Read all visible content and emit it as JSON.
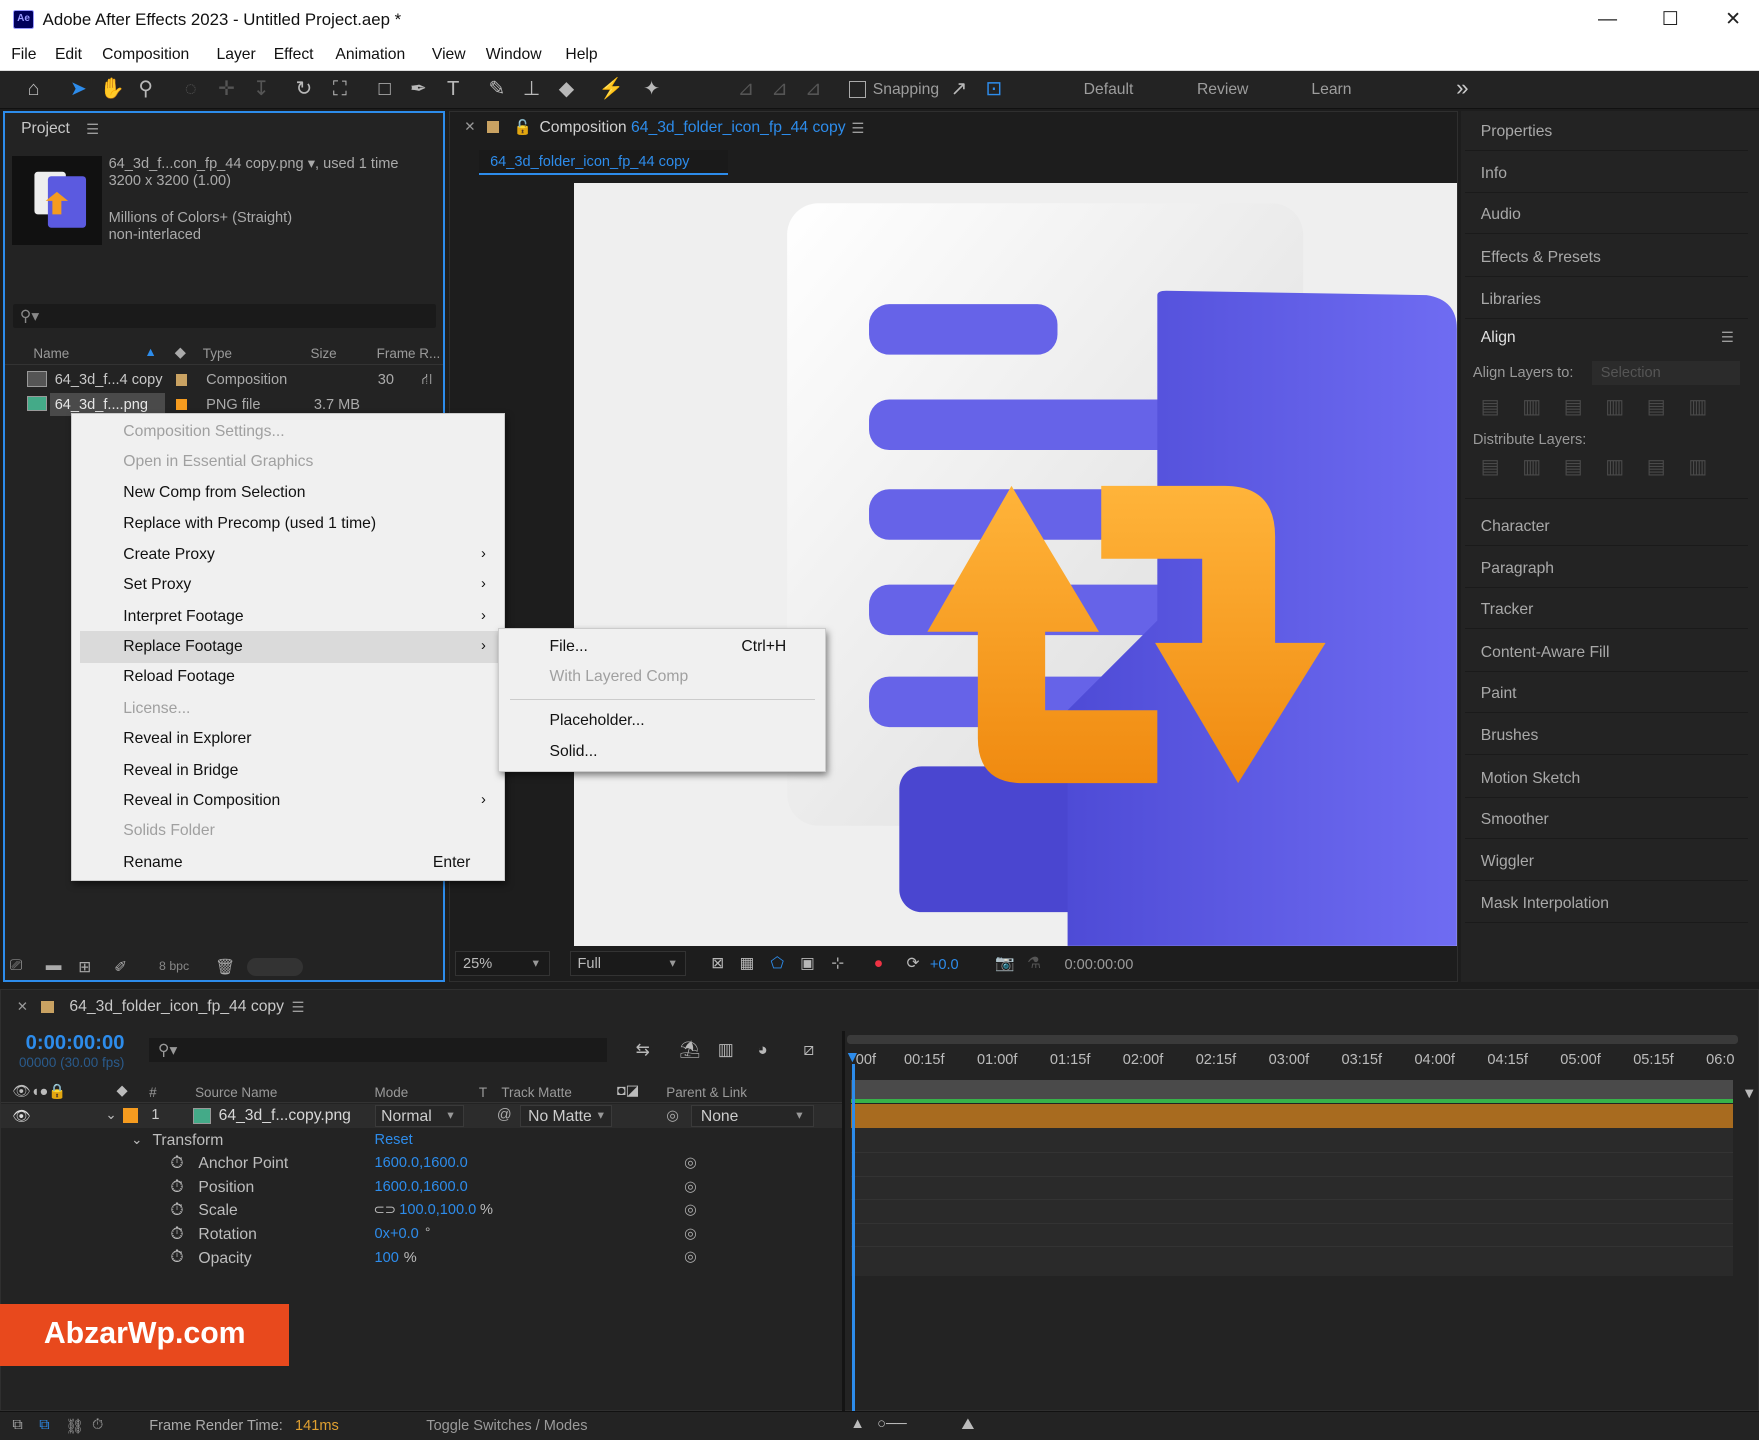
{
  "window": {
    "title": "Adobe After Effects 2023 - Untitled Project.aep *",
    "app_icon": "Ae",
    "minimize": "—",
    "maximize": "☐",
    "close": "✕"
  },
  "menu": [
    "File",
    "Edit",
    "Composition",
    "Layer",
    "Effect",
    "Animation",
    "View",
    "Window",
    "Help"
  ],
  "toolbar": {
    "snapping_label": "Snapping",
    "workspaces": [
      "Default",
      "Review",
      "Learn"
    ],
    "more": "»"
  },
  "project": {
    "title": "Project",
    "footage_name": "64_3d_f...con_fp_44 copy.png",
    "used": ", used 1 time",
    "dims": "3200 x 3200 (1.00)",
    "colors": "Millions of Colors+ (Straight)",
    "interlace": "non-interlaced",
    "columns": [
      "Name",
      "Type",
      "Size",
      "Frame R..."
    ],
    "rows": [
      {
        "name": "64_3d_f...4 copy",
        "type": "Composition",
        "size": "",
        "rate": "30"
      },
      {
        "name": "64_3d_f....png",
        "type": "PNG file",
        "size": "3.7 MB",
        "rate": ""
      }
    ],
    "bpc": "8 bpc"
  },
  "context_menu": {
    "items": [
      {
        "label": "Composition Settings...",
        "disabled": true
      },
      {
        "label": "Open in Essential Graphics",
        "disabled": true
      },
      {
        "label": "New Comp from Selection",
        "disabled": false
      },
      {
        "label": "Replace with Precomp (used 1 time)",
        "disabled": false
      },
      {
        "label": "Create Proxy",
        "disabled": false,
        "sub": true
      },
      {
        "label": "Set Proxy",
        "disabled": false,
        "sub": true
      },
      {
        "label": "Interpret Footage",
        "disabled": false,
        "sub": true
      },
      {
        "label": "Replace Footage",
        "disabled": false,
        "sub": true,
        "hover": true
      },
      {
        "label": "Reload Footage",
        "disabled": false
      },
      {
        "label": "License...",
        "disabled": true
      },
      {
        "label": "Reveal in Explorer",
        "disabled": false
      },
      {
        "label": "Reveal in Bridge",
        "disabled": false
      },
      {
        "label": "Reveal in Composition",
        "disabled": false,
        "sub": true
      },
      {
        "label": "Solids Folder",
        "disabled": true
      },
      {
        "label": "Rename",
        "disabled": false,
        "shortcut": "Enter"
      }
    ]
  },
  "submenu": {
    "file": "File...",
    "file_shortcut": "Ctrl+H",
    "layered": "With Layered Comp",
    "placeholder": "Placeholder...",
    "solid": "Solid..."
  },
  "composition": {
    "title_prefix": "Composition",
    "comp_name": "64_3d_folder_icon_fp_44 copy",
    "tab": "64_3d_folder_icon_fp_44 copy",
    "zoom": "25%",
    "resolution": "Full",
    "exposure": "+0.0",
    "timecode": "0:00:00:00"
  },
  "right_panels": {
    "top": [
      "Properties",
      "Info",
      "Audio",
      "Effects & Presets",
      "Libraries"
    ],
    "align_title": "Align",
    "align_layers_to": "Align Layers to:",
    "align_selection": "Selection",
    "distribute": "Distribute Layers:",
    "bottom": [
      "Character",
      "Paragraph",
      "Tracker",
      "Content-Aware Fill",
      "Paint",
      "Brushes",
      "Motion Sketch",
      "Smoother",
      "Wiggler",
      "Mask Interpolation"
    ]
  },
  "timeline": {
    "tab_name": "64_3d_folder_icon_fp_44 copy",
    "timecode": "0:00:00:00",
    "frames": "00000 (30.00 fps)",
    "columns": {
      "source": "Source Name",
      "mode": "Mode",
      "t": "T",
      "matte": "Track Matte",
      "parent": "Parent & Link",
      "num": "#"
    },
    "layer": {
      "num": "1",
      "name": "64_3d_f...copy.png",
      "mode": "Normal",
      "matte": "No Matte",
      "parent": "None"
    },
    "transform": "Transform",
    "reset": "Reset",
    "props": [
      {
        "name": "Anchor Point",
        "value": "1600.0,1600.0"
      },
      {
        "name": "Position",
        "value": "1600.0,1600.0"
      },
      {
        "name": "Scale",
        "value": "100.0,100.0",
        "unit": "%"
      },
      {
        "name": "Rotation",
        "value": "0x+0.0",
        "unit": "°"
      },
      {
        "name": "Opacity",
        "value": "100",
        "unit": "%"
      }
    ],
    "ticks": [
      "00f",
      "00:15f",
      "01:00f",
      "01:15f",
      "02:00f",
      "02:15f",
      "03:00f",
      "03:15f",
      "04:00f",
      "04:15f",
      "05:00f",
      "05:15f",
      "06:0"
    ]
  },
  "status": {
    "render_label": "Frame Render Time:",
    "render_value": "141ms",
    "toggle": "Toggle Switches / Modes"
  },
  "watermark": "AbzarWp.com",
  "colors": {
    "accent": "#2d8ceb",
    "label_orange": "#f59b1f",
    "watermark_bg": "#e8491d",
    "track_bar": "#a86b1f"
  }
}
